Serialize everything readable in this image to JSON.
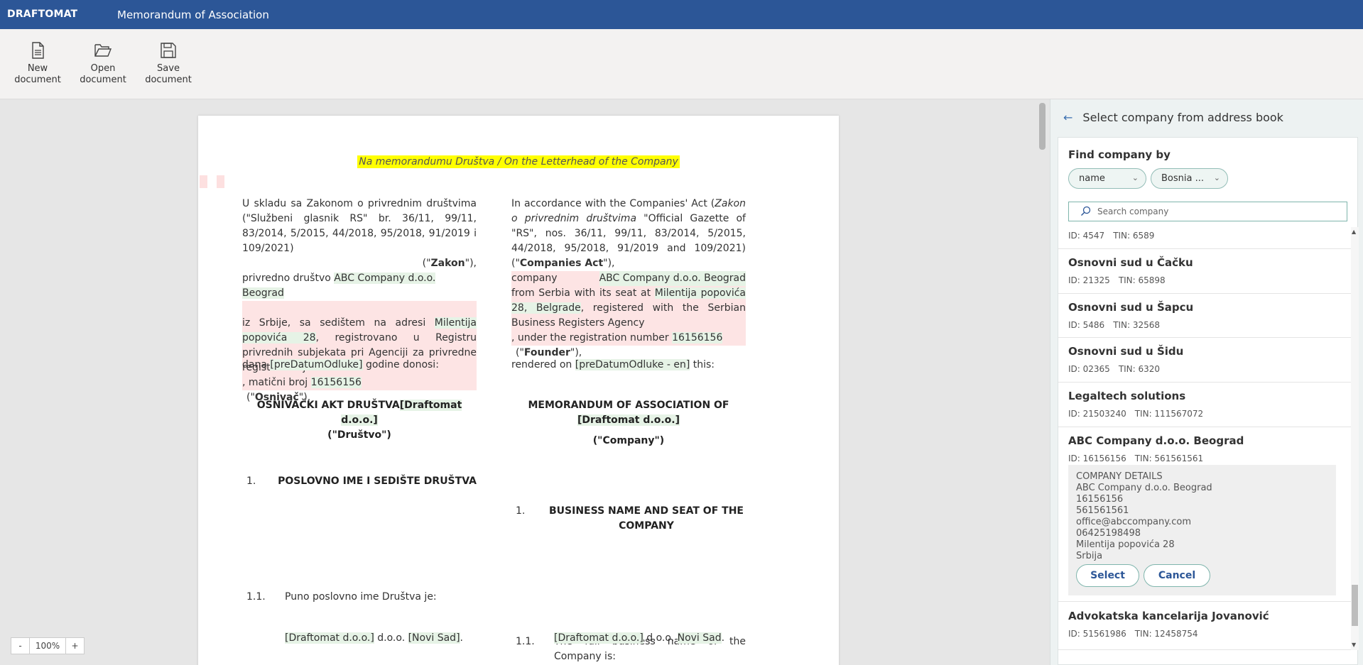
{
  "app": {
    "brand": "DRAFTOMAT",
    "document_title": "Memorandum of Association"
  },
  "toolbar": {
    "new": {
      "label": "New\ndocument",
      "icon": "new-document-icon"
    },
    "open": {
      "label": "Open\ndocument",
      "icon": "folder-open-icon"
    },
    "save": {
      "label": "Save\ndocument",
      "icon": "save-icon"
    }
  },
  "document": {
    "letterhead": "Na memorandumu Društva / On the Letterhead of the Company",
    "left": {
      "p1_intro": "U skladu sa Zakonom o privrednim društvima (\"Službeni glasnik RS\" br. 36/11, 99/11, 83/2014, 5/2015, 44/2018, 95/2018, 91/2019 i 109/2021)",
      "p1_zakon_open": "(\"",
      "p1_zakon": "Zakon",
      "p1_zakon_close": "\"),",
      "p1_drustvo": "privredno društvo ",
      "company": "ABC Company d.o.o. Beograd",
      "p2_a": "iz Srbije, sa sedištem na adresi ",
      "address": "Milentija popovića 28",
      "p2_b": ", registrovano u Registru privrednih subjekata pri Agenciji za privredne registre Srbije",
      "maticni_pre": ", matični broj ",
      "maticni": "16156156",
      "osnivac_open": "(\"",
      "osnivac": "Osnivač",
      "osnivac_close": "\"),",
      "dana_pre": "dana ",
      "dana_field": "[preDatumOdluke]",
      "dana_post": " godine donosi:",
      "title_a": "OSNIVAČKI AKT DRUŠTVA",
      "title_field": "[Draftomat d.o.o.]",
      "title_b": "(\"Društvo\")",
      "s1_num": "1.",
      "s1_title": "POSLOVNO IME I SEDIŠTE DRUŠTVA",
      "s11_num": "1.1.",
      "s11_text": "Puno poslovno ime Društva je:",
      "name_field": "[Draftomat d.o.o.]",
      "name_mid": " d.o.o. ",
      "city_field": "[Novi Sad]",
      "name_end": "."
    },
    "right": {
      "p1_a": "In accordance with the Companies' Act (",
      "p1_italic": "Zakon o privrednim društvima",
      "p1_b": " \"Official Gazette of \"RS\", nos. 36/11, 99/11, 83/2014, 5/2015, 44/2018, 95/2018, 91/2019 and 109/2021) (\"",
      "p1_bold": "Companies Act",
      "p1_c": "\"),",
      "company_pre": "company",
      "company": "ABC Company d.o.o. Beograd",
      "from_a": "from Serbia with its seat at ",
      "address": "Milentija popovića 28, Belgrade",
      "from_b": ", registered with the Serbian Business Registers Agency",
      "reg_pre": ", under the registration number ",
      "reg": "16156156",
      "founder_open": "(\"",
      "founder": "Founder",
      "founder_close": "\"),",
      "rendered_pre": "rendered on ",
      "rendered_field": "[preDatumOdluke - en]",
      "rendered_post": " this:",
      "title_a": "MEMORANDUM OF ASSOCIATION OF",
      "title_field": "[Draftomat d.o.o.]",
      "title_b": "(\"Company\")",
      "s1_num": "1.",
      "s1_title": "BUSINESS NAME AND SEAT OF THE COMPANY",
      "s11_num": "1.1.",
      "s11_text": "The full business name of the Company is:",
      "name_field": "[Draftomat d.o.o.]",
      "name_mid": " d.o.o. ",
      "city": "Novi Sad",
      "name_end": "."
    }
  },
  "zoom": {
    "minus": "-",
    "value": "100%",
    "plus": "+"
  },
  "panel": {
    "title": "Select company from address book",
    "find_label": "Find company by",
    "filter_field": "name",
    "filter_country": "Bosnia ...",
    "search_placeholder": "Search company",
    "items": [
      {
        "name": "",
        "id": "ID: 4547",
        "tin": "TIN: 6589"
      },
      {
        "name": "Osnovni sud u Čačku",
        "id": "ID: 21325",
        "tin": "TIN: 65898"
      },
      {
        "name": "Osnovni sud u Šapcu",
        "id": "ID: 5486",
        "tin": "TIN: 32568"
      },
      {
        "name": "Osnovni sud u Šidu",
        "id": "ID: 02365",
        "tin": "TIN: 6320"
      },
      {
        "name": "Legaltech solutions",
        "id": "ID: 21503240",
        "tin": "TIN: 111567072"
      },
      {
        "name": "ABC Company d.o.o. Beograd",
        "id": "ID: 16156156",
        "tin": "TIN: 561561561"
      },
      {
        "name": "Advokatska kancelarija Jovanović",
        "id": "ID: 51561986",
        "tin": "TIN: 12458754"
      }
    ],
    "details": {
      "heading": "COMPANY DETAILS",
      "lines": [
        "ABC Company d.o.o. Beograd",
        "16156156",
        "561561561",
        "office@abccompany.com",
        "06425198498",
        "Milentija popovića 28",
        "Srbija"
      ],
      "select": "Select",
      "cancel": "Cancel"
    }
  },
  "colors": {
    "header": "#2c5697",
    "highlight_yellow": "#ffff00",
    "field_green": "#e6f3e6",
    "field_pink": "#fde4e4",
    "panel_bg": "#edf2f2",
    "accent_teal": "#7fb5ac"
  }
}
